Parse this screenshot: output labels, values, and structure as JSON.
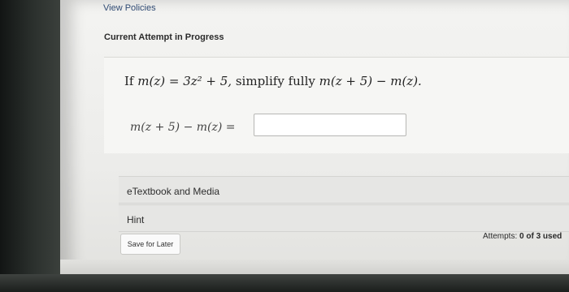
{
  "header": {
    "view_policies": "View Policies",
    "section_title": "Current Attempt in Progress"
  },
  "question": {
    "prefix": "If",
    "function_def": "m(z) = 3z² + 5,",
    "instruction": "simplify fully",
    "expression": "m(z + 5) − m(z).",
    "answer_label": "m(z + 5) − m(z) =",
    "answer_value": ""
  },
  "accordions": {
    "etextbook_label": "eTextbook and Media",
    "hint_label": "Hint"
  },
  "footer": {
    "save_label": "Save for Later",
    "attempts_label": "Attempts:",
    "attempts_value": "0 of 3 used"
  }
}
